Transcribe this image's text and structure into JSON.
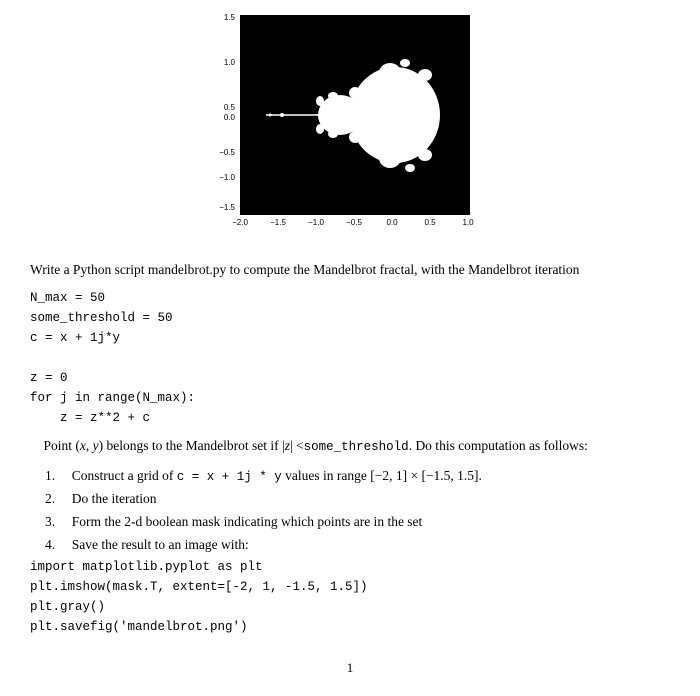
{
  "plot": {
    "alt": "Mandelbrot fractal image"
  },
  "description": "Write a Python script mandelbrot.py to compute the Mandelbrot fractal, with the Mandelbrot iteration",
  "code_setup": "N_max = 50\nsome_threshold = 50\nc = x + 1j*y\n\nz = 0\nfor j in range(N_max):\n    z = z**2 + c",
  "explanation": "Point (x, y) belongs to the Mandelbrot set if |z| <some_threshold. Do this computation as follows:",
  "list": [
    {
      "number": "1.",
      "text_before": "Construct a grid of ",
      "code": "c = x + 1j * y",
      "text_after": " values in range [−2, 1] × [−1.5, 1.5]."
    },
    {
      "number": "2.",
      "text": "Do the iteration"
    },
    {
      "number": "3.",
      "text": "Form the 2-d boolean mask indicating which points are in the set"
    },
    {
      "number": "4.",
      "text": "Save the result to an image with:"
    }
  ],
  "code_plot": "import matplotlib.pyplot as plt\nplt.imshow(mask.T, extent=[-2, 1, -1.5, 1.5])\nplt.gray()\nplt.savefig('mandelbrot.png')",
  "page_number": "1"
}
